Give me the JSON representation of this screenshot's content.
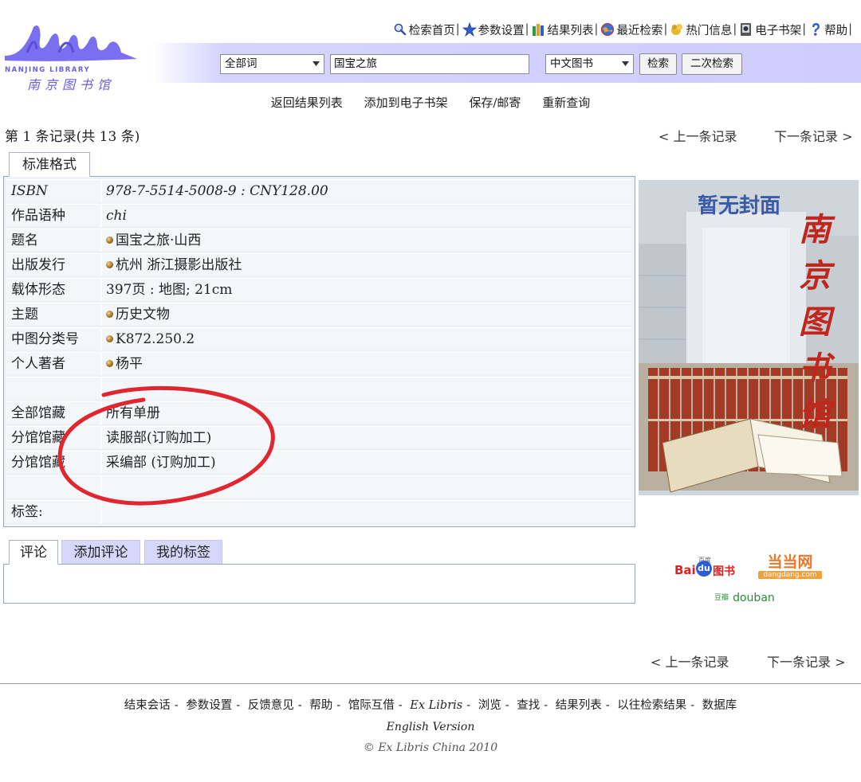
{
  "header": {
    "logo_text_en": "NANJING LIBRARY",
    "logo_text_cn": "南京图书馆",
    "top_links": [
      {
        "label": "检索首页",
        "icon": "magnifier-icon"
      },
      {
        "label": "参数设置",
        "icon": "star-settings-icon"
      },
      {
        "label": "结果列表",
        "icon": "books-list-icon"
      },
      {
        "label": "最近检索",
        "icon": "globe-icon"
      },
      {
        "label": "热门信息",
        "icon": "hot-info-icon"
      },
      {
        "label": "电子书架",
        "icon": "ebook-shelf-icon"
      },
      {
        "label": "帮助",
        "icon": "help-icon"
      }
    ],
    "separator": "|"
  },
  "search": {
    "field_select": "全部词",
    "query": "国宝之旅",
    "database_select": "中文图书",
    "search_button": "检索",
    "secondary_search_button": "二次检索"
  },
  "actions": [
    "返回结果列表",
    "添加到电子书架",
    "保存/邮寄",
    "重新查询"
  ],
  "record_nav": {
    "record_info": "第 1 条记录(共 13 条)",
    "prev": "< 上一条记录",
    "next": "下一条记录 >"
  },
  "format_tab": "标准格式",
  "record": {
    "rows": [
      {
        "label": "ISBN",
        "value": "978-7-5514-5008-9 : CNY128.00"
      },
      {
        "label": "作品语种",
        "value": "chi"
      },
      {
        "label": "题名",
        "value": "国宝之旅·山西"
      },
      {
        "label": "出版发行",
        "value": "杭州 浙江摄影出版社"
      },
      {
        "label": "载体形态",
        "value": "397页 : 地图; 21cm"
      },
      {
        "label": "主题",
        "value": "历史文物"
      },
      {
        "label": "中图分类号",
        "value": "K872.250.2"
      },
      {
        "label": "个人著者",
        "value": "杨平"
      },
      {
        "label": "",
        "value": ""
      },
      {
        "label": "全部馆藏",
        "value": "所有单册"
      },
      {
        "label": "分馆馆藏",
        "value": "读服部(订购加工)"
      },
      {
        "label": "分馆馆藏",
        "value": "采编部 (订购加工)"
      },
      {
        "label": "",
        "value": ""
      },
      {
        "label": "标签:",
        "value": ""
      }
    ]
  },
  "cover": {
    "no_cover_text": "暂无封面",
    "vertical_text": [
      "南",
      "京",
      "图",
      "书",
      "馆"
    ]
  },
  "comment_tabs": [
    "评论",
    "添加评论",
    "我的标签"
  ],
  "partners": {
    "baidu": "Bai",
    "baidu_du": "du",
    "baidu_book": "图书",
    "baidu_small": "百度",
    "dangdang": "当当网",
    "dangdang_url": "dangdang.com",
    "douban_cn": "豆瓣",
    "douban": "douban"
  },
  "footer": {
    "prev": "< 上一条记录",
    "next": "下一条记录 >",
    "links": [
      "结束会话",
      "参数设置",
      "反馈意见",
      "帮助",
      "馆际互借",
      "Ex Libris",
      "浏览",
      "查找",
      "结果列表",
      "以往检索结果",
      "数据库"
    ],
    "english_version": "English Version",
    "copyright": "© Ex Libris China 2010"
  },
  "colors": {
    "accent_purple": "#7a6ff0",
    "search_bar": "#cfccff",
    "table_bg": "#eef3f7",
    "annotation_red": "#e0262f"
  }
}
